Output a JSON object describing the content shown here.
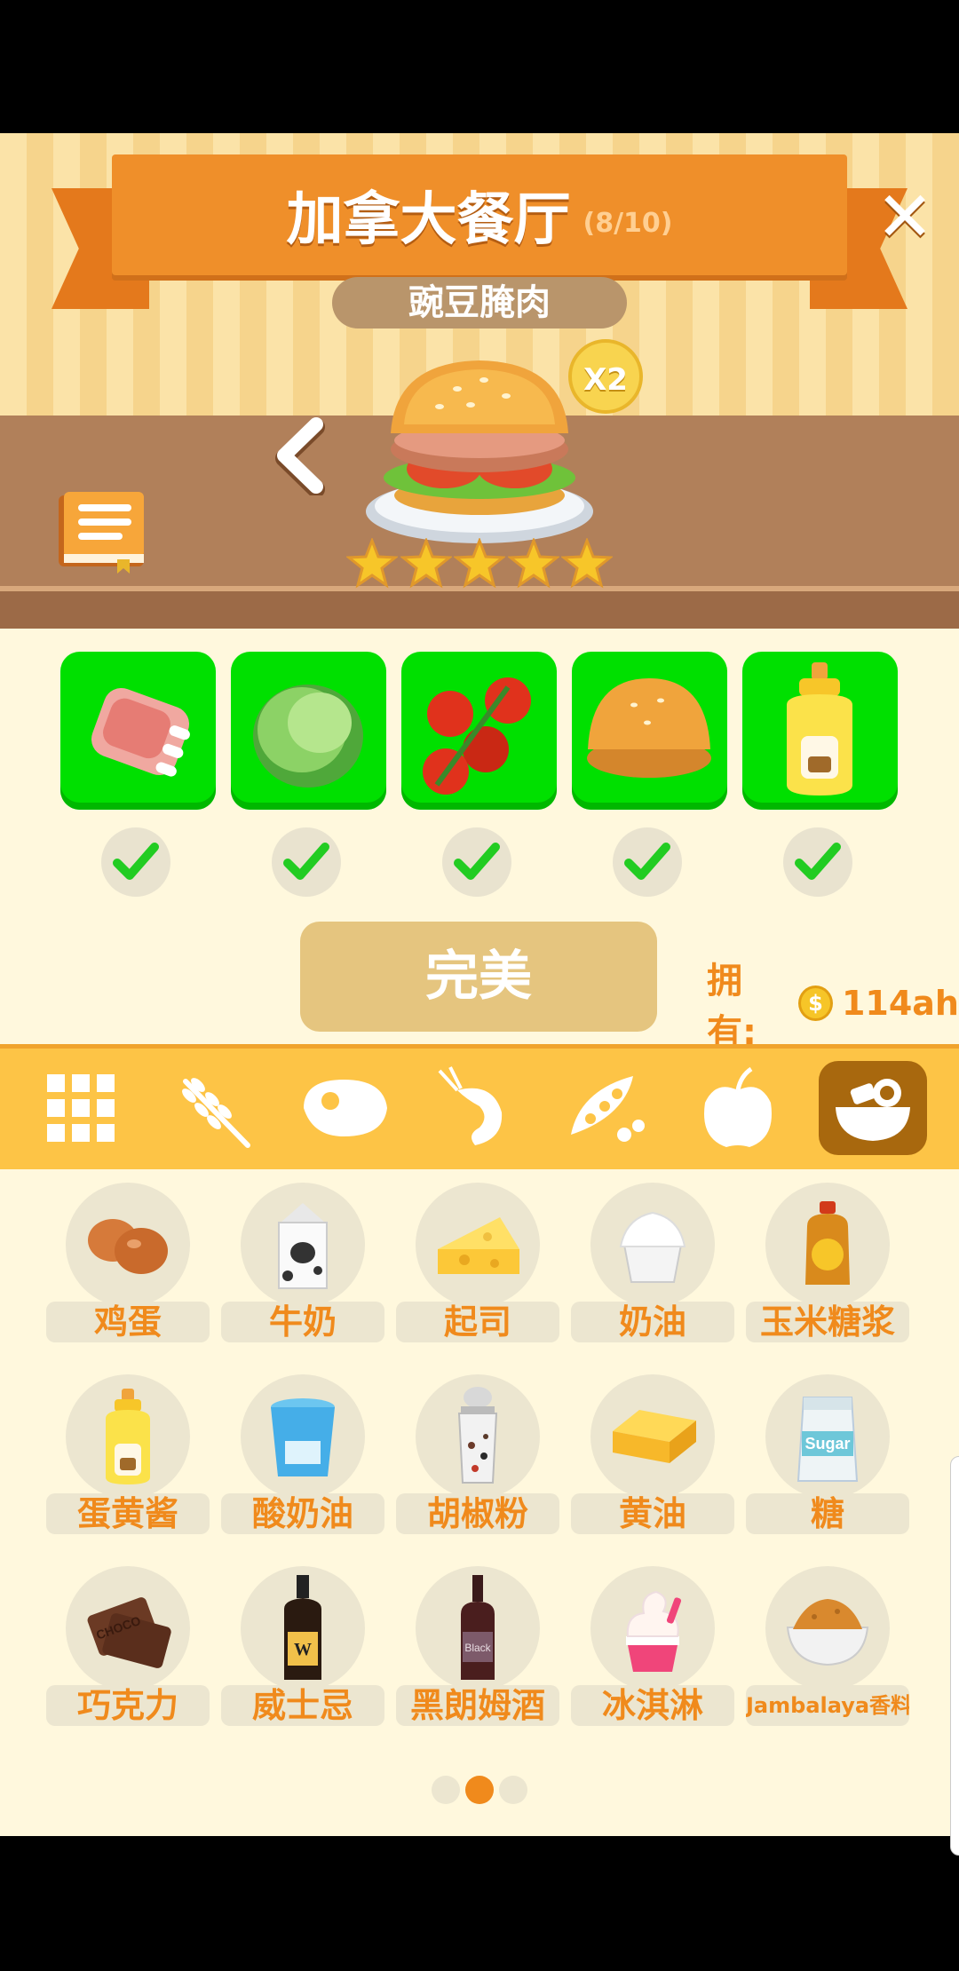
{
  "header": {
    "title": "加拿大餐厅",
    "count": "(8/10)",
    "close_label": "✕",
    "dish_name": "豌豆腌肉",
    "multiplier": "X2",
    "star_rating": 5
  },
  "recipe_ingredients": [
    {
      "name": "meat",
      "checked": true
    },
    {
      "name": "lettuce",
      "checked": true
    },
    {
      "name": "tomato",
      "checked": true
    },
    {
      "name": "bun",
      "checked": true
    },
    {
      "name": "mayonnaise",
      "checked": true
    }
  ],
  "result": {
    "button_label": "完美",
    "owned_label": "拥有:",
    "coin_symbol": "$",
    "owned_value": "114ah"
  },
  "category_tabs": [
    {
      "name": "all",
      "active": false
    },
    {
      "name": "grain",
      "active": false
    },
    {
      "name": "meat",
      "active": false
    },
    {
      "name": "seafood",
      "active": false
    },
    {
      "name": "vegetable",
      "active": false
    },
    {
      "name": "fruit",
      "active": false
    },
    {
      "name": "dairy-seasoning",
      "active": true
    }
  ],
  "ingredients": [
    {
      "label": "鸡蛋",
      "icon": "egg-icon"
    },
    {
      "label": "牛奶",
      "icon": "milk-icon"
    },
    {
      "label": "起司",
      "icon": "cheese-icon"
    },
    {
      "label": "奶油",
      "icon": "cream-icon"
    },
    {
      "label": "玉米糖浆",
      "icon": "corn-syrup-icon"
    },
    {
      "label": "蛋黄酱",
      "icon": "mayonnaise-icon"
    },
    {
      "label": "酸奶油",
      "icon": "sour-cream-icon"
    },
    {
      "label": "胡椒粉",
      "icon": "pepper-icon"
    },
    {
      "label": "黄油",
      "icon": "butter-icon"
    },
    {
      "label": "糖",
      "icon": "sugar-icon",
      "pic_text": "Sugar"
    },
    {
      "label": "巧克力",
      "icon": "chocolate-icon",
      "pic_text": "CHOCO"
    },
    {
      "label": "威士忌",
      "icon": "whiskey-icon",
      "pic_text": "W"
    },
    {
      "label": "黑朗姆酒",
      "icon": "dark-rum-icon",
      "pic_text": "Black"
    },
    {
      "label": "冰淇淋",
      "icon": "ice-cream-icon"
    },
    {
      "label": "Jambalaya香料",
      "icon": "jambalaya-spice-icon"
    }
  ],
  "pagination": {
    "pages": 3,
    "current": 2
  },
  "colors": {
    "accent": "#f08a1c",
    "ingredient_bg": "#00e000",
    "check": "#22cc22",
    "ribbon": "#ef8f2a"
  }
}
